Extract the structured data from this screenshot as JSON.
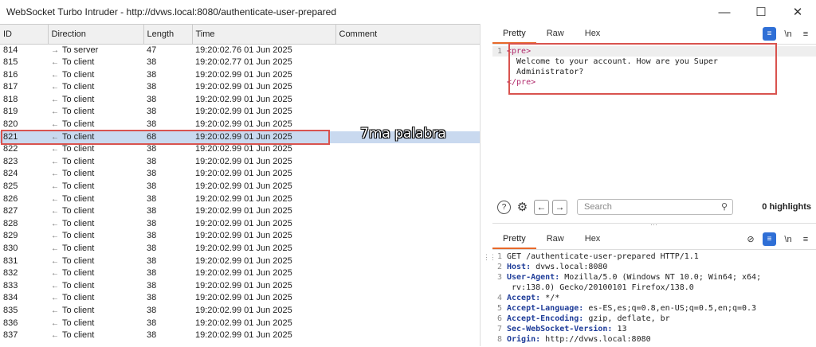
{
  "window": {
    "title": "WebSocket Turbo Intruder - http://dvws.local:8080/authenticate-user-prepared",
    "minimize": "—",
    "maximize": "☐",
    "close": "✕"
  },
  "table": {
    "headers": [
      "ID",
      "Direction",
      "Length",
      "Time",
      "Comment"
    ],
    "rows": [
      {
        "id": "814",
        "dir_icon": "→",
        "dir": "To server",
        "length": "47",
        "time": "19:20:02.76 01 Jun 2025",
        "comment": ""
      },
      {
        "id": "815",
        "dir_icon": "←",
        "dir": "To client",
        "length": "38",
        "time": "19:20:02.77 01 Jun 2025",
        "comment": ""
      },
      {
        "id": "816",
        "dir_icon": "←",
        "dir": "To client",
        "length": "38",
        "time": "19:20:02.99 01 Jun 2025",
        "comment": ""
      },
      {
        "id": "817",
        "dir_icon": "←",
        "dir": "To client",
        "length": "38",
        "time": "19:20:02.99 01 Jun 2025",
        "comment": ""
      },
      {
        "id": "818",
        "dir_icon": "←",
        "dir": "To client",
        "length": "38",
        "time": "19:20:02.99 01 Jun 2025",
        "comment": ""
      },
      {
        "id": "819",
        "dir_icon": "←",
        "dir": "To client",
        "length": "38",
        "time": "19:20:02.99 01 Jun 2025",
        "comment": ""
      },
      {
        "id": "820",
        "dir_icon": "←",
        "dir": "To client",
        "length": "38",
        "time": "19:20:02.99 01 Jun 2025",
        "comment": ""
      },
      {
        "id": "821",
        "dir_icon": "←",
        "dir": "To client",
        "length": "68",
        "time": "19:20:02.99 01 Jun 2025",
        "comment": "",
        "selected": true
      },
      {
        "id": "822",
        "dir_icon": "←",
        "dir": "To client",
        "length": "38",
        "time": "19:20:02.99 01 Jun 2025",
        "comment": ""
      },
      {
        "id": "823",
        "dir_icon": "←",
        "dir": "To client",
        "length": "38",
        "time": "19:20:02.99 01 Jun 2025",
        "comment": ""
      },
      {
        "id": "824",
        "dir_icon": "←",
        "dir": "To client",
        "length": "38",
        "time": "19:20:02.99 01 Jun 2025",
        "comment": ""
      },
      {
        "id": "825",
        "dir_icon": "←",
        "dir": "To client",
        "length": "38",
        "time": "19:20:02.99 01 Jun 2025",
        "comment": ""
      },
      {
        "id": "826",
        "dir_icon": "←",
        "dir": "To client",
        "length": "38",
        "time": "19:20:02.99 01 Jun 2025",
        "comment": ""
      },
      {
        "id": "827",
        "dir_icon": "←",
        "dir": "To client",
        "length": "38",
        "time": "19:20:02.99 01 Jun 2025",
        "comment": ""
      },
      {
        "id": "828",
        "dir_icon": "←",
        "dir": "To client",
        "length": "38",
        "time": "19:20:02.99 01 Jun 2025",
        "comment": ""
      },
      {
        "id": "829",
        "dir_icon": "←",
        "dir": "To client",
        "length": "38",
        "time": "19:20:02.99 01 Jun 2025",
        "comment": ""
      },
      {
        "id": "830",
        "dir_icon": "←",
        "dir": "To client",
        "length": "38",
        "time": "19:20:02.99 01 Jun 2025",
        "comment": ""
      },
      {
        "id": "831",
        "dir_icon": "←",
        "dir": "To client",
        "length": "38",
        "time": "19:20:02.99 01 Jun 2025",
        "comment": ""
      },
      {
        "id": "832",
        "dir_icon": "←",
        "dir": "To client",
        "length": "38",
        "time": "19:20:02.99 01 Jun 2025",
        "comment": ""
      },
      {
        "id": "833",
        "dir_icon": "←",
        "dir": "To client",
        "length": "38",
        "time": "19:20:02.99 01 Jun 2025",
        "comment": ""
      },
      {
        "id": "834",
        "dir_icon": "←",
        "dir": "To client",
        "length": "38",
        "time": "19:20:02.99 01 Jun 2025",
        "comment": ""
      },
      {
        "id": "835",
        "dir_icon": "←",
        "dir": "To client",
        "length": "38",
        "time": "19:20:02.99 01 Jun 2025",
        "comment": ""
      },
      {
        "id": "836",
        "dir_icon": "←",
        "dir": "To client",
        "length": "38",
        "time": "19:20:02.99 01 Jun 2025",
        "comment": ""
      },
      {
        "id": "837",
        "dir_icon": "←",
        "dir": "To client",
        "length": "38",
        "time": "19:20:02.99 01 Jun 2025",
        "comment": ""
      }
    ]
  },
  "annotation": "7ma palabra",
  "response": {
    "tabs": [
      "Pretty",
      "Raw",
      "Hex"
    ],
    "active_tab": "Pretty",
    "icons": {
      "format": "≡",
      "newline": "\\n",
      "menu": "≡"
    },
    "lines": [
      {
        "n": "1",
        "text": "<pre>"
      },
      {
        "n": "",
        "text": "  Welcome to your account. How are you Super"
      },
      {
        "n": "",
        "text": "  Administrator?"
      },
      {
        "n": "",
        "text": "</pre>"
      }
    ]
  },
  "search": {
    "help": "?",
    "settings": "⚙",
    "prev": "←",
    "next": "→",
    "placeholder": "Search",
    "search_icon": "⚲",
    "highlights": "0 highlights"
  },
  "request": {
    "tabs": [
      "Pretty",
      "Raw",
      "Hex"
    ],
    "active_tab": "Pretty",
    "icons": {
      "hide": "⊘",
      "format": "≡",
      "newline": "\\n",
      "menu": "≡"
    },
    "lines": [
      {
        "n": "1",
        "key": "",
        "value": "GET /authenticate-user-prepared HTTP/1.1"
      },
      {
        "n": "2",
        "key": "Host:",
        "value": " dvws.local:8080"
      },
      {
        "n": "3",
        "key": "User-Agent:",
        "value": " Mozilla/5.0 (Windows NT 10.0; Win64; x64;"
      },
      {
        "n": "",
        "key": "",
        "value": " rv:138.0) Gecko/20100101 Firefox/138.0"
      },
      {
        "n": "4",
        "key": "Accept:",
        "value": " */*"
      },
      {
        "n": "5",
        "key": "Accept-Language:",
        "value": " es-ES,es;q=0.8,en-US;q=0.5,en;q=0.3"
      },
      {
        "n": "6",
        "key": "Accept-Encoding:",
        "value": " gzip, deflate, br"
      },
      {
        "n": "7",
        "key": "Sec-WebSocket-Version:",
        "value": " 13"
      },
      {
        "n": "8",
        "key": "Origin:",
        "value": " http://dvws.local:8080"
      }
    ]
  }
}
